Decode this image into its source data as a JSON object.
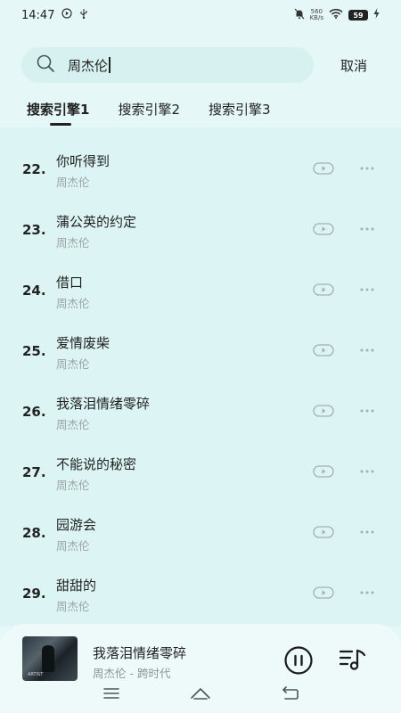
{
  "status_bar": {
    "time": "14:47",
    "speed_value": "560",
    "speed_unit": "KB/s",
    "battery": "59",
    "icons": [
      "play-circle-icon",
      "usb-icon",
      "mute-bell-icon",
      "wifi-icon",
      "battery-icon",
      "charging-icon"
    ]
  },
  "search": {
    "query": "周杰伦",
    "cancel_label": "取消"
  },
  "tabs": [
    {
      "label": "搜索引擎1",
      "active": true
    },
    {
      "label": "搜索引擎2",
      "active": false
    },
    {
      "label": "搜索引擎3",
      "active": false
    }
  ],
  "songs": [
    {
      "index": "22.",
      "title": "你听得到",
      "artist": "周杰伦"
    },
    {
      "index": "23.",
      "title": "蒲公英的约定",
      "artist": "周杰伦"
    },
    {
      "index": "24.",
      "title": "借口",
      "artist": "周杰伦"
    },
    {
      "index": "25.",
      "title": "爱情废柴",
      "artist": "周杰伦"
    },
    {
      "index": "26.",
      "title": "我落泪情绪零碎",
      "artist": "周杰伦"
    },
    {
      "index": "27.",
      "title": "不能说的秘密",
      "artist": "周杰伦"
    },
    {
      "index": "28.",
      "title": "园游会",
      "artist": "周杰伦"
    },
    {
      "index": "29.",
      "title": "甜甜的",
      "artist": "周杰伦"
    }
  ],
  "now_playing": {
    "title": "我落泪情绪零碎",
    "subtitle": "周杰伦 - 跨时代",
    "album_text": "ARTIST"
  },
  "colors": {
    "background": "#e5f7f6",
    "search_bg": "#d6f1ef",
    "muted_text": "#9aa5a4"
  }
}
